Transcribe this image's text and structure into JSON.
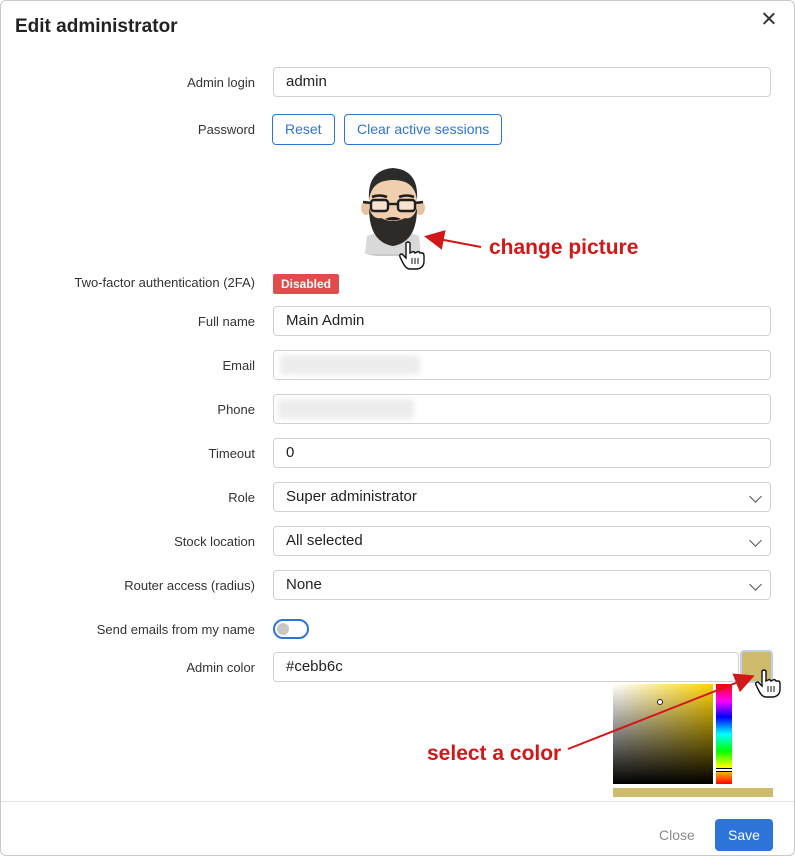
{
  "dialog": {
    "title": "Edit administrator",
    "close_icon": "close-icon"
  },
  "form": {
    "admin_login": {
      "label": "Admin login",
      "value": "admin"
    },
    "password": {
      "label": "Password",
      "reset_label": "Reset",
      "clear_sessions_label": "Clear active sessions"
    },
    "avatar": {
      "icon": "bearded-avatar-icon"
    },
    "two_fa": {
      "label": "Two-factor authentication (2FA)",
      "status": "Disabled",
      "status_color": "#e24b4b"
    },
    "full_name": {
      "label": "Full name",
      "value": "Main Admin"
    },
    "email": {
      "label": "Email"
    },
    "phone": {
      "label": "Phone"
    },
    "timeout": {
      "label": "Timeout",
      "value": "0"
    },
    "role": {
      "label": "Role",
      "value": "Super administrator"
    },
    "stock_location": {
      "label": "Stock location",
      "value": "All selected"
    },
    "router_access": {
      "label": "Router access (radius)",
      "value": "None"
    },
    "send_emails": {
      "label": "Send emails from my name",
      "enabled": false
    },
    "admin_color": {
      "label": "Admin color",
      "value": "#cebb6c",
      "color": "#cebb6c"
    }
  },
  "color_picker": {
    "hue_color": "#ffd400",
    "selected_color": "#cebb6c"
  },
  "annotations": {
    "change_picture": "change picture",
    "select_color": "select a color",
    "color": "#d01818"
  },
  "footer": {
    "close_label": "Close",
    "save_label": "Save",
    "accent": "#2c74d8"
  }
}
